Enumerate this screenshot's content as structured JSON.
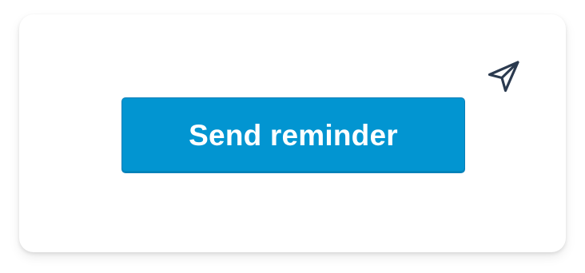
{
  "card": {
    "button_label": "Send reminder",
    "icon": "paper-plane-icon"
  },
  "colors": {
    "button_bg": "#0295d1",
    "button_text": "#ffffff",
    "icon_stroke": "#2b3a4f",
    "card_bg": "#ffffff"
  }
}
